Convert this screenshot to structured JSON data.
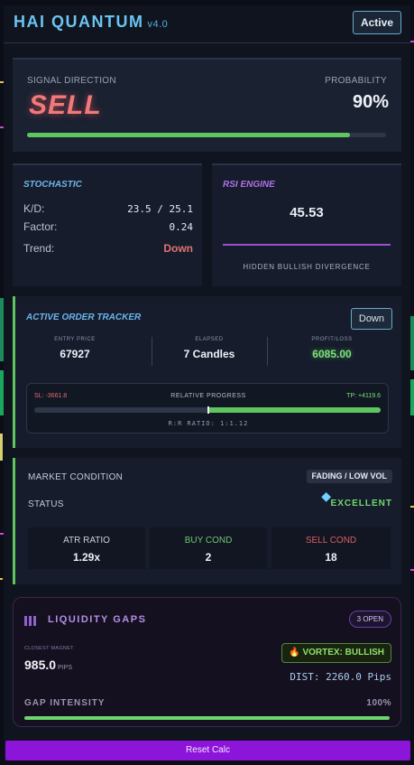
{
  "header": {
    "title": "HAI QUANTUM",
    "version": "v4.0",
    "status_button": "Active"
  },
  "signal": {
    "direction_label": "SIGNAL DIRECTION",
    "direction": "SELL",
    "probability_label": "PROBABILITY",
    "probability": "90%",
    "probability_fraction": 0.9
  },
  "stochastic": {
    "title": "STOCHASTIC",
    "kd_label": "K/D:",
    "kd_value": "23.5 / 25.1",
    "factor_label": "Factor:",
    "factor_value": "0.24",
    "trend_label": "Trend:",
    "trend_value": "Down"
  },
  "rsi": {
    "title": "RSI ENGINE",
    "value": "45.53",
    "note": "HIDDEN BULLISH DIVERGENCE"
  },
  "tracker": {
    "title": "ACTIVE ORDER TRACKER",
    "direction_button": "Down",
    "entry_label": "ENTRY PRICE",
    "entry_value": "67927",
    "elapsed_label": "ELAPSED",
    "elapsed_value": "7 Candles",
    "pl_label": "PROFIT/LOSS",
    "pl_value": "6085.00",
    "sl": "SL: -3661.8",
    "progress_label": "RELATIVE PROGRESS",
    "tp": "TP: +4119.6",
    "rr": "R:R RATIO: 1:1.12",
    "progress_fraction": 0.5
  },
  "market": {
    "condition_label": "MARKET CONDITION",
    "condition_value": "FADING / LOW VOL",
    "status_label": "STATUS",
    "status_icon": "gem-icon",
    "status_value": "EXCELLENT",
    "atr_label": "ATR RATIO",
    "atr_value": "1.29x",
    "buy_label": "BUY COND",
    "buy_value": "2",
    "sell_label": "SELL COND",
    "sell_value": "18"
  },
  "liquidity": {
    "title": "LIQUIDITY GAPS",
    "open_badge": "3 OPEN",
    "closest_label": "CLOSEST MAGNET",
    "closest_value": "985.0",
    "closest_unit": "PIPS",
    "vortex": "VORTEX: BULLISH",
    "dist": "DIST: 2260.0 Pips",
    "intensity_label": "GAP INTENSITY",
    "intensity_value": "100%",
    "intensity_fraction": 1.0
  },
  "reset_button": "Reset Calc",
  "colors": {
    "sell": "#f07a7a",
    "green": "#5fc65f",
    "accent_blue": "#6cc4f0",
    "purple": "#9a4fd6",
    "reset": "#8d14d9"
  }
}
